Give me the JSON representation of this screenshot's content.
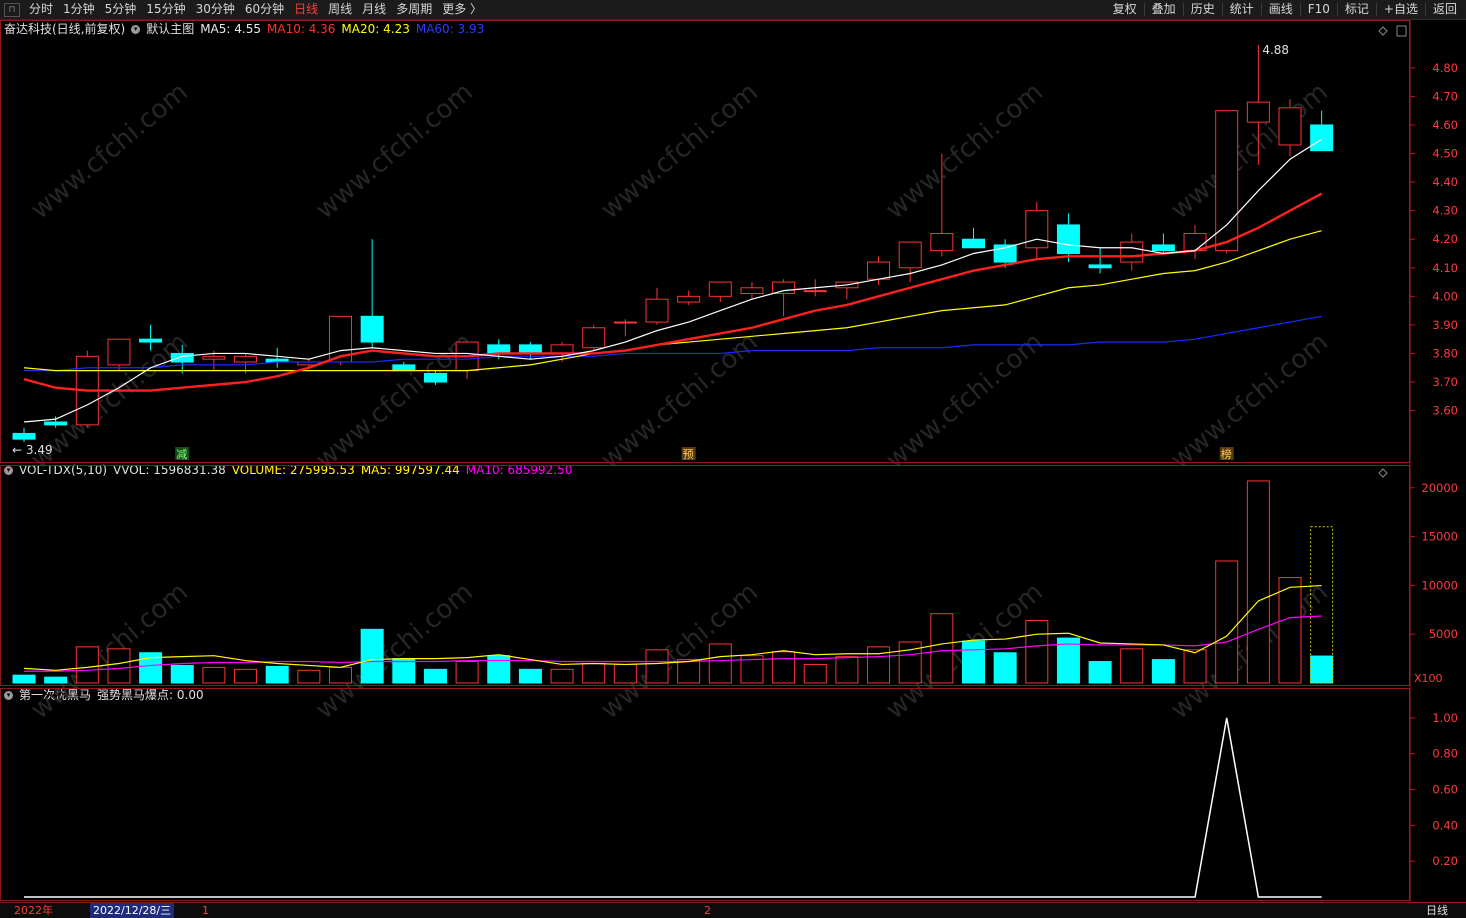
{
  "toolbar": {
    "left_items": [
      "分时",
      "1分钟",
      "5分钟",
      "15分钟",
      "30分钟",
      "60分钟",
      "日线",
      "周线",
      "月线",
      "多周期",
      "更多 〉"
    ],
    "active_index": 6,
    "right_items": [
      "复权",
      "叠加",
      "历史",
      "统计",
      "画线",
      "F10",
      "标记",
      "+自选",
      "返回"
    ]
  },
  "main_panel": {
    "title": "奋达科技(日线,前复权)",
    "template": "默认主图",
    "ma5_label": "MA5:",
    "ma5_value": "4.55",
    "ma10_label": "MA10:",
    "ma10_value": "4.36",
    "ma20_label": "MA20:",
    "ma20_value": "4.23",
    "ma60_label": "MA60:",
    "ma60_value": "3.93",
    "high_label": "4.88",
    "low_label": "← 3.49",
    "markers": [
      "减",
      "预",
      "榜"
    ]
  },
  "volume_panel": {
    "title": "VOL-TDX(5,10)",
    "vvol_label": "VVOL:",
    "vvol_value": "1596831.38",
    "volume_label": "VOLUME:",
    "volume_value": "275995.53",
    "ma5_label": "MA5:",
    "ma5_value": "997597.44",
    "ma10_label": "MA10:",
    "ma10_value": "685992.50",
    "unit": "X100"
  },
  "indicator_panel": {
    "title": "第一次优黑马",
    "signal_label": "强势黑马爆点:",
    "signal_value": "0.00"
  },
  "bottom_bar": {
    "year": "2022年",
    "date": "2022/12/28/三",
    "month1": "1",
    "month2": "2",
    "period": "日线"
  },
  "colors": {
    "up": "#ff3232",
    "down": "#00ffff",
    "ma5": "#ffffff",
    "ma10": "#ff2020",
    "ma20": "#ffff00",
    "ma60": "#1a2bff",
    "vol_ma10": "#ff00ff",
    "axis": "#b01e1e"
  },
  "chart_data": [
    {
      "type": "candlestick",
      "ylim": [
        3.49,
        4.88
      ],
      "y_ticks": [
        3.6,
        3.7,
        3.8,
        3.9,
        4.0,
        4.1,
        4.2,
        4.3,
        4.4,
        4.5,
        4.6,
        4.7,
        4.8
      ],
      "ohlc": [
        [
          3.52,
          3.54,
          3.49,
          3.5
        ],
        [
          3.56,
          3.58,
          3.54,
          3.55
        ],
        [
          3.55,
          3.81,
          3.54,
          3.79
        ],
        [
          3.76,
          3.84,
          3.74,
          3.85
        ],
        [
          3.85,
          3.9,
          3.81,
          3.84
        ],
        [
          3.8,
          3.83,
          3.73,
          3.77
        ],
        [
          3.78,
          3.81,
          3.74,
          3.79
        ],
        [
          3.77,
          3.8,
          3.73,
          3.79
        ],
        [
          3.78,
          3.82,
          3.75,
          3.77
        ],
        [
          3.76,
          3.78,
          3.75,
          3.77
        ],
        [
          3.77,
          3.93,
          3.76,
          3.93
        ],
        [
          3.93,
          4.2,
          3.82,
          3.84
        ],
        [
          3.76,
          3.77,
          3.74,
          3.74
        ],
        [
          3.73,
          3.74,
          3.69,
          3.7
        ],
        [
          3.74,
          3.84,
          3.71,
          3.84
        ],
        [
          3.83,
          3.85,
          3.78,
          3.8
        ],
        [
          3.83,
          3.84,
          3.78,
          3.8
        ],
        [
          3.8,
          3.84,
          3.77,
          3.83
        ],
        [
          3.82,
          3.9,
          3.81,
          3.89
        ],
        [
          3.91,
          3.92,
          3.86,
          3.91
        ],
        [
          3.91,
          4.03,
          3.9,
          3.99
        ],
        [
          3.98,
          4.02,
          3.97,
          4.0
        ],
        [
          4.0,
          4.05,
          3.98,
          4.05
        ],
        [
          4.01,
          4.05,
          3.99,
          4.03
        ],
        [
          4.01,
          4.06,
          3.93,
          4.05
        ],
        [
          4.02,
          4.06,
          4.0,
          4.02
        ],
        [
          4.03,
          4.05,
          3.99,
          4.05
        ],
        [
          4.06,
          4.14,
          4.04,
          4.12
        ],
        [
          4.1,
          4.19,
          4.05,
          4.19
        ],
        [
          4.16,
          4.5,
          4.14,
          4.22
        ],
        [
          4.2,
          4.24,
          4.17,
          4.17
        ],
        [
          4.18,
          4.2,
          4.1,
          4.12
        ],
        [
          4.17,
          4.33,
          4.13,
          4.3
        ],
        [
          4.25,
          4.29,
          4.12,
          4.15
        ],
        [
          4.11,
          4.17,
          4.08,
          4.1
        ],
        [
          4.12,
          4.22,
          4.09,
          4.19
        ],
        [
          4.18,
          4.22,
          4.15,
          4.16
        ],
        [
          4.16,
          4.25,
          4.13,
          4.22
        ],
        [
          4.16,
          4.65,
          4.15,
          4.65
        ],
        [
          4.61,
          4.88,
          4.46,
          4.68
        ],
        [
          4.53,
          4.69,
          4.49,
          4.66
        ],
        [
          4.6,
          4.65,
          4.51,
          4.51
        ]
      ],
      "ma5": [
        3.56,
        3.57,
        3.62,
        3.68,
        3.75,
        3.79,
        3.8,
        3.8,
        3.79,
        3.78,
        3.81,
        3.82,
        3.81,
        3.8,
        3.8,
        3.79,
        3.78,
        3.79,
        3.81,
        3.84,
        3.88,
        3.91,
        3.95,
        3.99,
        4.02,
        4.03,
        4.04,
        4.06,
        4.08,
        4.11,
        4.15,
        4.17,
        4.2,
        4.18,
        4.17,
        4.17,
        4.15,
        4.16,
        4.25,
        4.37,
        4.48,
        4.55
      ],
      "ma10": [
        3.71,
        3.68,
        3.67,
        3.67,
        3.67,
        3.68,
        3.69,
        3.7,
        3.72,
        3.75,
        3.79,
        3.81,
        3.8,
        3.79,
        3.79,
        3.8,
        3.8,
        3.8,
        3.8,
        3.81,
        3.83,
        3.85,
        3.87,
        3.89,
        3.92,
        3.95,
        3.97,
        4.0,
        4.03,
        4.06,
        4.09,
        4.11,
        4.13,
        4.14,
        4.14,
        4.14,
        4.15,
        4.16,
        4.19,
        4.24,
        4.3,
        4.36
      ],
      "ma20": [
        3.75,
        3.74,
        3.74,
        3.74,
        3.74,
        3.74,
        3.74,
        3.74,
        3.74,
        3.74,
        3.74,
        3.74,
        3.74,
        3.74,
        3.74,
        3.75,
        3.76,
        3.78,
        3.8,
        3.81,
        3.83,
        3.84,
        3.85,
        3.86,
        3.87,
        3.88,
        3.89,
        3.91,
        3.93,
        3.95,
        3.96,
        3.97,
        4.0,
        4.03,
        4.04,
        4.06,
        4.08,
        4.09,
        4.12,
        4.16,
        4.2,
        4.23
      ],
      "ma60": [
        3.74,
        3.74,
        3.75,
        3.75,
        3.75,
        3.76,
        3.76,
        3.76,
        3.77,
        3.77,
        3.77,
        3.77,
        3.78,
        3.78,
        3.78,
        3.79,
        3.79,
        3.79,
        3.79,
        3.8,
        3.8,
        3.8,
        3.8,
        3.81,
        3.81,
        3.81,
        3.81,
        3.82,
        3.82,
        3.82,
        3.83,
        3.83,
        3.83,
        3.83,
        3.84,
        3.84,
        3.84,
        3.85,
        3.87,
        3.89,
        3.91,
        3.93
      ]
    },
    {
      "type": "bar",
      "title": "VOL-TDX(5,10)",
      "unit": "X100",
      "ylim": [
        0,
        21000
      ],
      "y_ticks": [
        5000,
        10000,
        15000,
        20000
      ],
      "volume": [
        800,
        600,
        3700,
        3500,
        3100,
        1800,
        1600,
        1400,
        1700,
        1300,
        1600,
        5500,
        2500,
        1400,
        2200,
        2800,
        1400,
        1400,
        2000,
        1900,
        3400,
        2400,
        4000,
        2800,
        3200,
        1900,
        2700,
        3700,
        4200,
        7100,
        4300,
        3100,
        6400,
        4600,
        2200,
        3500,
        2400,
        3400,
        12500,
        20700,
        10800,
        2760
      ],
      "volume_outline": 16000,
      "ma5": [
        1500,
        1300,
        1600,
        2000,
        2600,
        2700,
        2800,
        2300,
        2000,
        1800,
        1600,
        2400,
        2500,
        2500,
        2600,
        2900,
        2400,
        1900,
        2000,
        1900,
        2000,
        2200,
        2700,
        2900,
        3300,
        2900,
        3000,
        3000,
        3400,
        4000,
        4400,
        4500,
        5000,
        5100,
        4100,
        4000,
        3900,
        3100,
        4800,
        8400,
        9800,
        9980
      ],
      "ma10": [
        1200,
        1200,
        1300,
        1500,
        1800,
        2000,
        2100,
        2100,
        2200,
        2200,
        2100,
        2200,
        2200,
        2200,
        2300,
        2300,
        2300,
        2200,
        2200,
        2200,
        2200,
        2200,
        2300,
        2400,
        2500,
        2500,
        2600,
        2700,
        2900,
        3300,
        3400,
        3500,
        3800,
        4000,
        3900,
        3900,
        3900,
        3800,
        4200,
        5500,
        6700,
        6860
      ]
    },
    {
      "type": "line",
      "title": "第一次优黑马",
      "ylim": [
        0,
        1.1
      ],
      "y_ticks": [
        0.2,
        0.4,
        0.6,
        0.8,
        1.0
      ],
      "values": [
        0,
        0,
        0,
        0,
        0,
        0,
        0,
        0,
        0,
        0,
        0,
        0,
        0,
        0,
        0,
        0,
        0,
        0,
        0,
        0,
        0,
        0,
        0,
        0,
        0,
        0,
        0,
        0,
        0,
        0,
        0,
        0,
        0,
        0,
        0,
        0,
        0,
        0,
        1,
        0,
        0,
        0
      ]
    }
  ]
}
